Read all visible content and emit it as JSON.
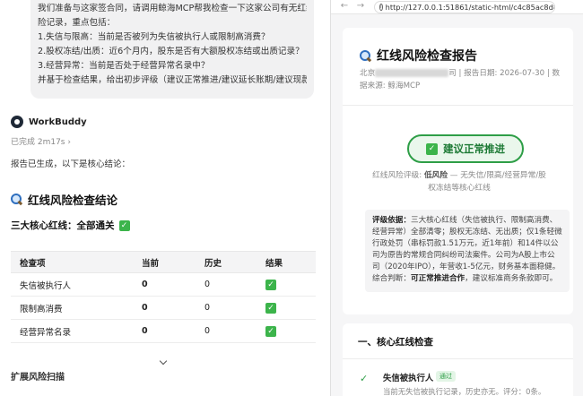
{
  "chat": {
    "user_lines": [
      "我们准备与这家签合同，请调用鲸海MCP帮我检查一下这家公司有无红线风",
      "险记录，重点包括：",
      "1.失信与限高：当前是否被列为失信被执行人或限制高消费？",
      "2.股权冻结/出质：近6个月内，股东是否有大额股权冻结或出质记录？",
      "3.经营异常：当前是否处于经营异常名录中？",
      "并基于检查结果，给出初步评级（建议正常推进/建议延长账期/建议现款）"
    ],
    "bot_name": "WorkBuddy",
    "status": "已完成 2m17s ›",
    "done_text": "报告已生成，以下是核心结论：",
    "section_title": "红线风险检查结论",
    "redline_summary": "三大核心红线：全部通关",
    "table": {
      "headers": [
        "检查项",
        "当前",
        "历史",
        "结果"
      ],
      "rows": [
        {
          "item": "失信被执行人",
          "current": "0",
          "history": "0",
          "result": "✓"
        },
        {
          "item": "限制高消费",
          "current": "0",
          "history": "0",
          "result": "✓"
        },
        {
          "item": "经营异常名录",
          "current": "0",
          "history": "0",
          "result": "✓"
        }
      ]
    },
    "expand_label": "扩展风险扫描"
  },
  "browser": {
    "back": "←",
    "forward": "→",
    "url": "http://127.0.0.1:51861/static-html/c4c85ac8d8f",
    "report": {
      "title": "红线风险检查报告",
      "meta_prefix": "北京",
      "meta_suffix": "司 | 报告日期: 2026-07-30 | 数据来源: 鲸海MCP",
      "verdict": "建议正常推进",
      "level_prefix": "红线风险评级: ",
      "level_value": "低风险",
      "level_suffix": " — 无失信/限高/经营异常/股权冻结等核心红线",
      "basis_label": "评级依据：",
      "basis_text": "三大核心红线（失信被执行、限制高消费、经营异常）全部清零；股权无冻结、无出质；仅1条轻微行政处罚（串标罚款1.51万元，近1年前）和14件以公司为原告的常规合同纠纷司法案件。公司为A股上市公司（2020年IPO），年营收1-5亿元，财务基本面稳健。综合判断：",
      "basis_conclusion": "可正常推进合作",
      "basis_tail": "，建议标准商务条款即可。",
      "section1_title": "一、核心红线检查",
      "item1_name": "失信被执行人",
      "item1_badge": "通过",
      "item1_desc": "当前无失信被执行记录，历史亦无。评分：0条。"
    }
  },
  "colors": {
    "accent_green": "#2e9e47",
    "verdict_bg": "#eaf7ec"
  }
}
